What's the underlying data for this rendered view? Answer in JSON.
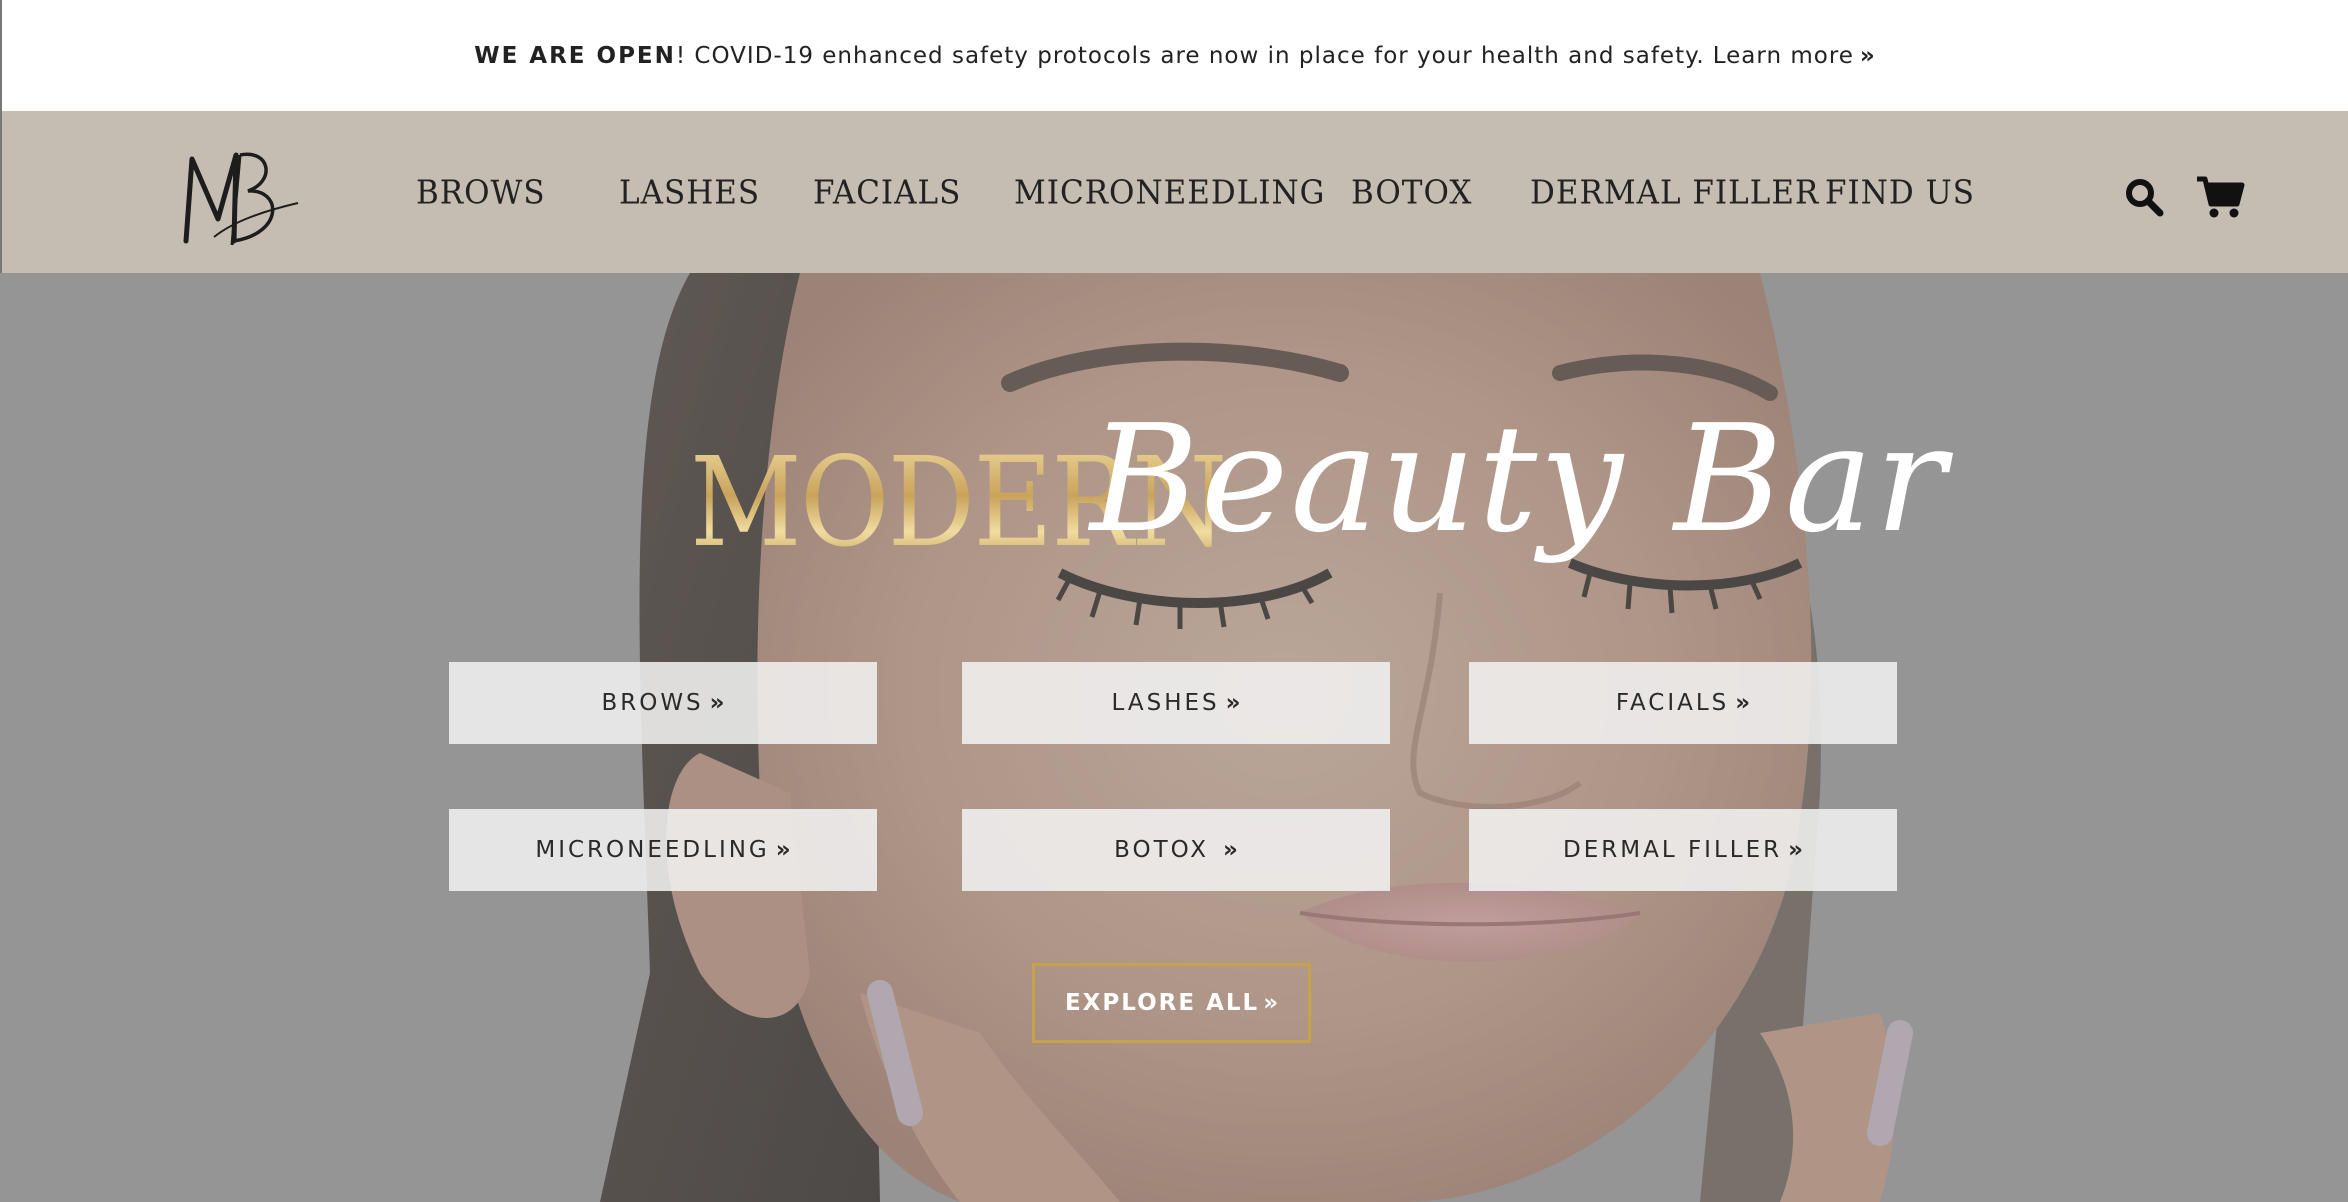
{
  "announcement": {
    "strong": "WE ARE OPEN",
    "text": "! COVID-19 enhanced safety protocols are now in place for your health and safety.",
    "link": "Learn more",
    "chevron": "»"
  },
  "header": {
    "logo_text": "MB",
    "nav": [
      "BROWS",
      "LASHES",
      "FACIALS",
      "MICRONEEDLING",
      "BOTOX",
      "DERMAL FILLER",
      "FIND US"
    ],
    "search_icon": "search-icon",
    "cart_icon": "cart-icon"
  },
  "hero": {
    "title_modern": "MODERN",
    "title_script": "Beauty Bar",
    "services": [
      "BROWS",
      "LASHES",
      "FACIALS",
      "MICRONEEDLING",
      "BOTOX",
      "DERMAL FILLER"
    ],
    "chevron": "»",
    "explore_label": "EXPLORE ALL"
  },
  "colors": {
    "header_bg": "#c5bdb2",
    "hero_overlay": "#9a9a9a",
    "gold_accent": "#c7a24b"
  }
}
